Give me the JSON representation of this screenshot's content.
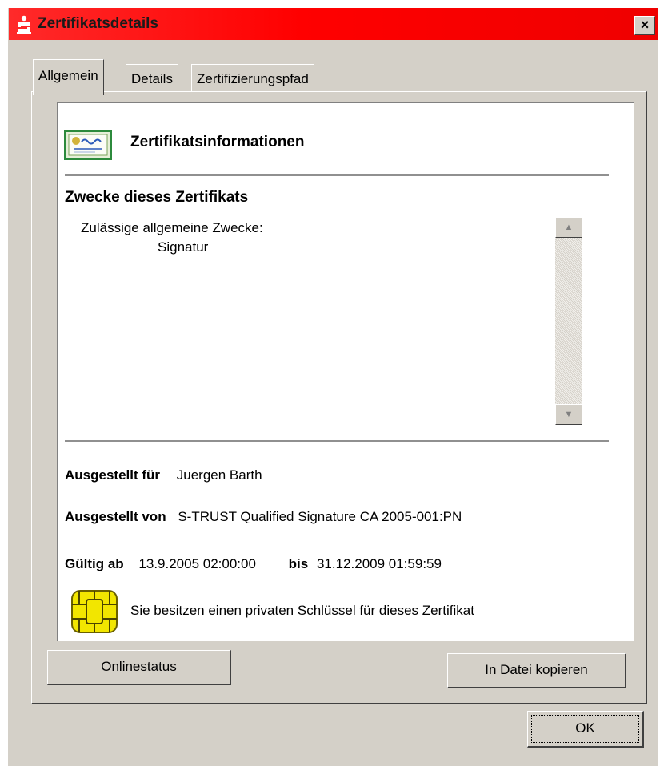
{
  "window": {
    "title": "Zertifikatsdetails",
    "close_label": "×"
  },
  "tabs": [
    {
      "label": "Allgemein"
    },
    {
      "label": "Details"
    },
    {
      "label": "Zertifizierungspfad"
    }
  ],
  "header": {
    "title": "Zertifikatsinformationen"
  },
  "purposes": {
    "title": "Zwecke dieses Zertifikats",
    "line1": "Zulässige allgemeine Zwecke:",
    "line2": "Signatur"
  },
  "issued_to": {
    "label": "Ausgestellt für",
    "value": "Juergen Barth"
  },
  "issued_by": {
    "label": "Ausgestellt von",
    "value": "S-TRUST Qualified Signature CA 2005-001:PN"
  },
  "validity": {
    "from_label": "Gültig ab",
    "from_value": "13.9.2005 02:00:00",
    "to_label": "bis",
    "to_value": "31.12.2009 01:59:59"
  },
  "private_key_note": "Sie besitzen einen privaten Schlüssel für dieses Zertifikat",
  "buttons": {
    "online_status": "Onlinestatus",
    "copy_to_file": "In Datei kopieren",
    "ok": "OK"
  },
  "colors": {
    "titlebar": "#ff0000",
    "face": "#d4d0c8",
    "chip": "#f2e600"
  }
}
